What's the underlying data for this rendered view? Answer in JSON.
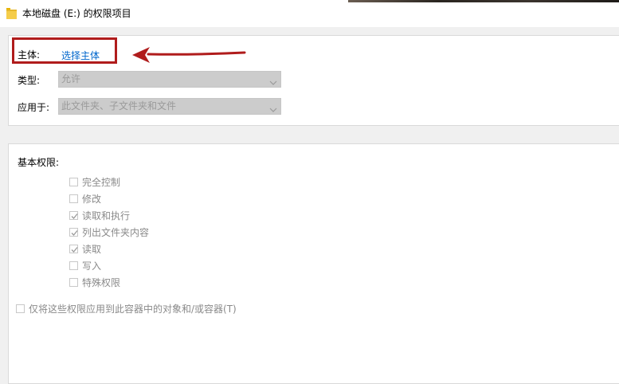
{
  "window": {
    "title": "本地磁盘 (E:) 的权限项目",
    "folder_icon": "folder-icon"
  },
  "principal": {
    "label": "主体:",
    "link": "选择主体"
  },
  "type": {
    "label": "类型:",
    "value": "允许"
  },
  "applies_to": {
    "label": "应用于:",
    "value": "此文件夹、子文件夹和文件"
  },
  "basic_permissions": {
    "heading": "基本权限:",
    "items": [
      {
        "label": "完全控制",
        "checked": false
      },
      {
        "label": "修改",
        "checked": false
      },
      {
        "label": "读取和执行",
        "checked": true
      },
      {
        "label": "列出文件夹内容",
        "checked": true
      },
      {
        "label": "读取",
        "checked": true
      },
      {
        "label": "写入",
        "checked": false
      },
      {
        "label": "特殊权限",
        "checked": false
      }
    ]
  },
  "apply_only": {
    "label": "仅将这些权限应用到此容器中的对象和/或容器(T)",
    "checked": false
  },
  "colors": {
    "highlight_box": "#b01c1c",
    "link": "#0066cc"
  }
}
